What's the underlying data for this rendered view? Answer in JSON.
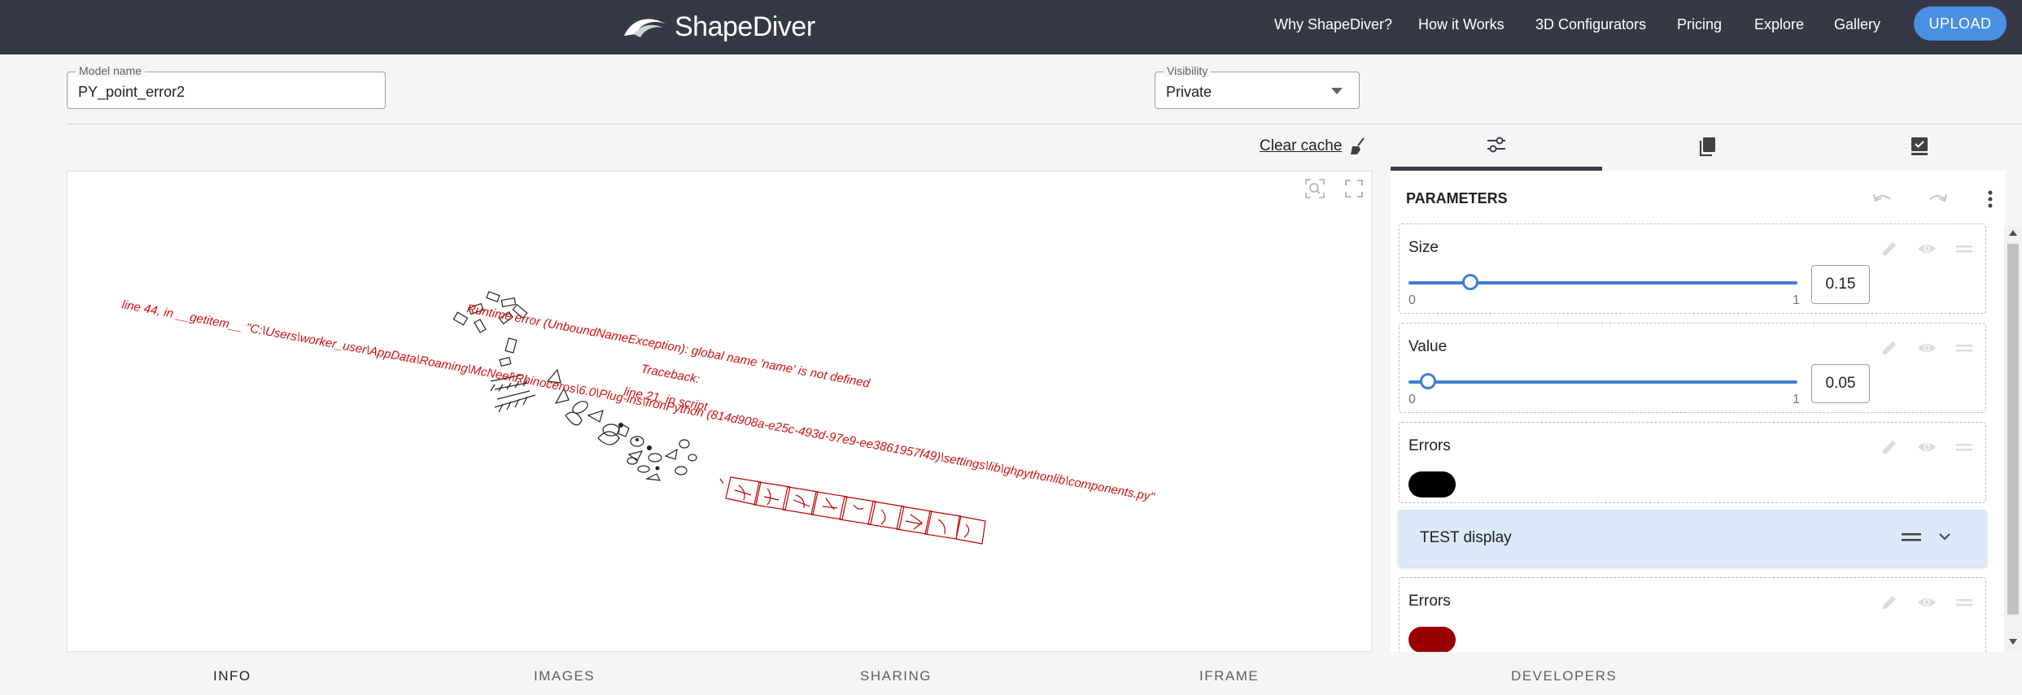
{
  "brand": {
    "name": "ShapeDiver"
  },
  "nav": {
    "links": [
      "Why ShapeDiver?",
      "How it Works",
      "3D Configurators",
      "Pricing",
      "Explore",
      "Gallery"
    ],
    "upload": "UPLOAD"
  },
  "model": {
    "label": "Model name",
    "value": "PY_point_error2"
  },
  "visibility": {
    "label": "Visibility",
    "value": "Private"
  },
  "toolbar": {
    "clear_cache": "Clear cache"
  },
  "viewer": {
    "errors": {
      "e1": "line 44, in __getitem__  \"C:\\Users\\worker_user\\AppData\\Roaming\\McNeel\\Rhinoceros\\6.0\\Plug-ins\\IronPython (814d908a-e25c-493d-97e9-ee3861957f49)\\settings\\lib\\ghpythonlib\\components.py\"",
      "e2": "Runtime error (UnboundNameException): global name 'name' is not defined",
      "e3": "Traceback:",
      "e4": "line 21, in script"
    }
  },
  "panel": {
    "title": "PARAMETERS",
    "params": [
      {
        "label": "Size",
        "min": "0",
        "max": "1",
        "value": "0.15",
        "fraction": 0.15
      },
      {
        "label": "Value",
        "min": "0",
        "max": "1",
        "value": "0.05",
        "fraction": 0.05
      }
    ],
    "errors1": {
      "label": "Errors",
      "color": "#000000"
    },
    "group": {
      "label": "TEST display"
    },
    "errors2": {
      "label": "Errors",
      "color": "#9b0000"
    }
  },
  "bottom_tabs": [
    "INFO",
    "IMAGES",
    "SHARING",
    "IFRAME",
    "DEVELOPERS"
  ]
}
